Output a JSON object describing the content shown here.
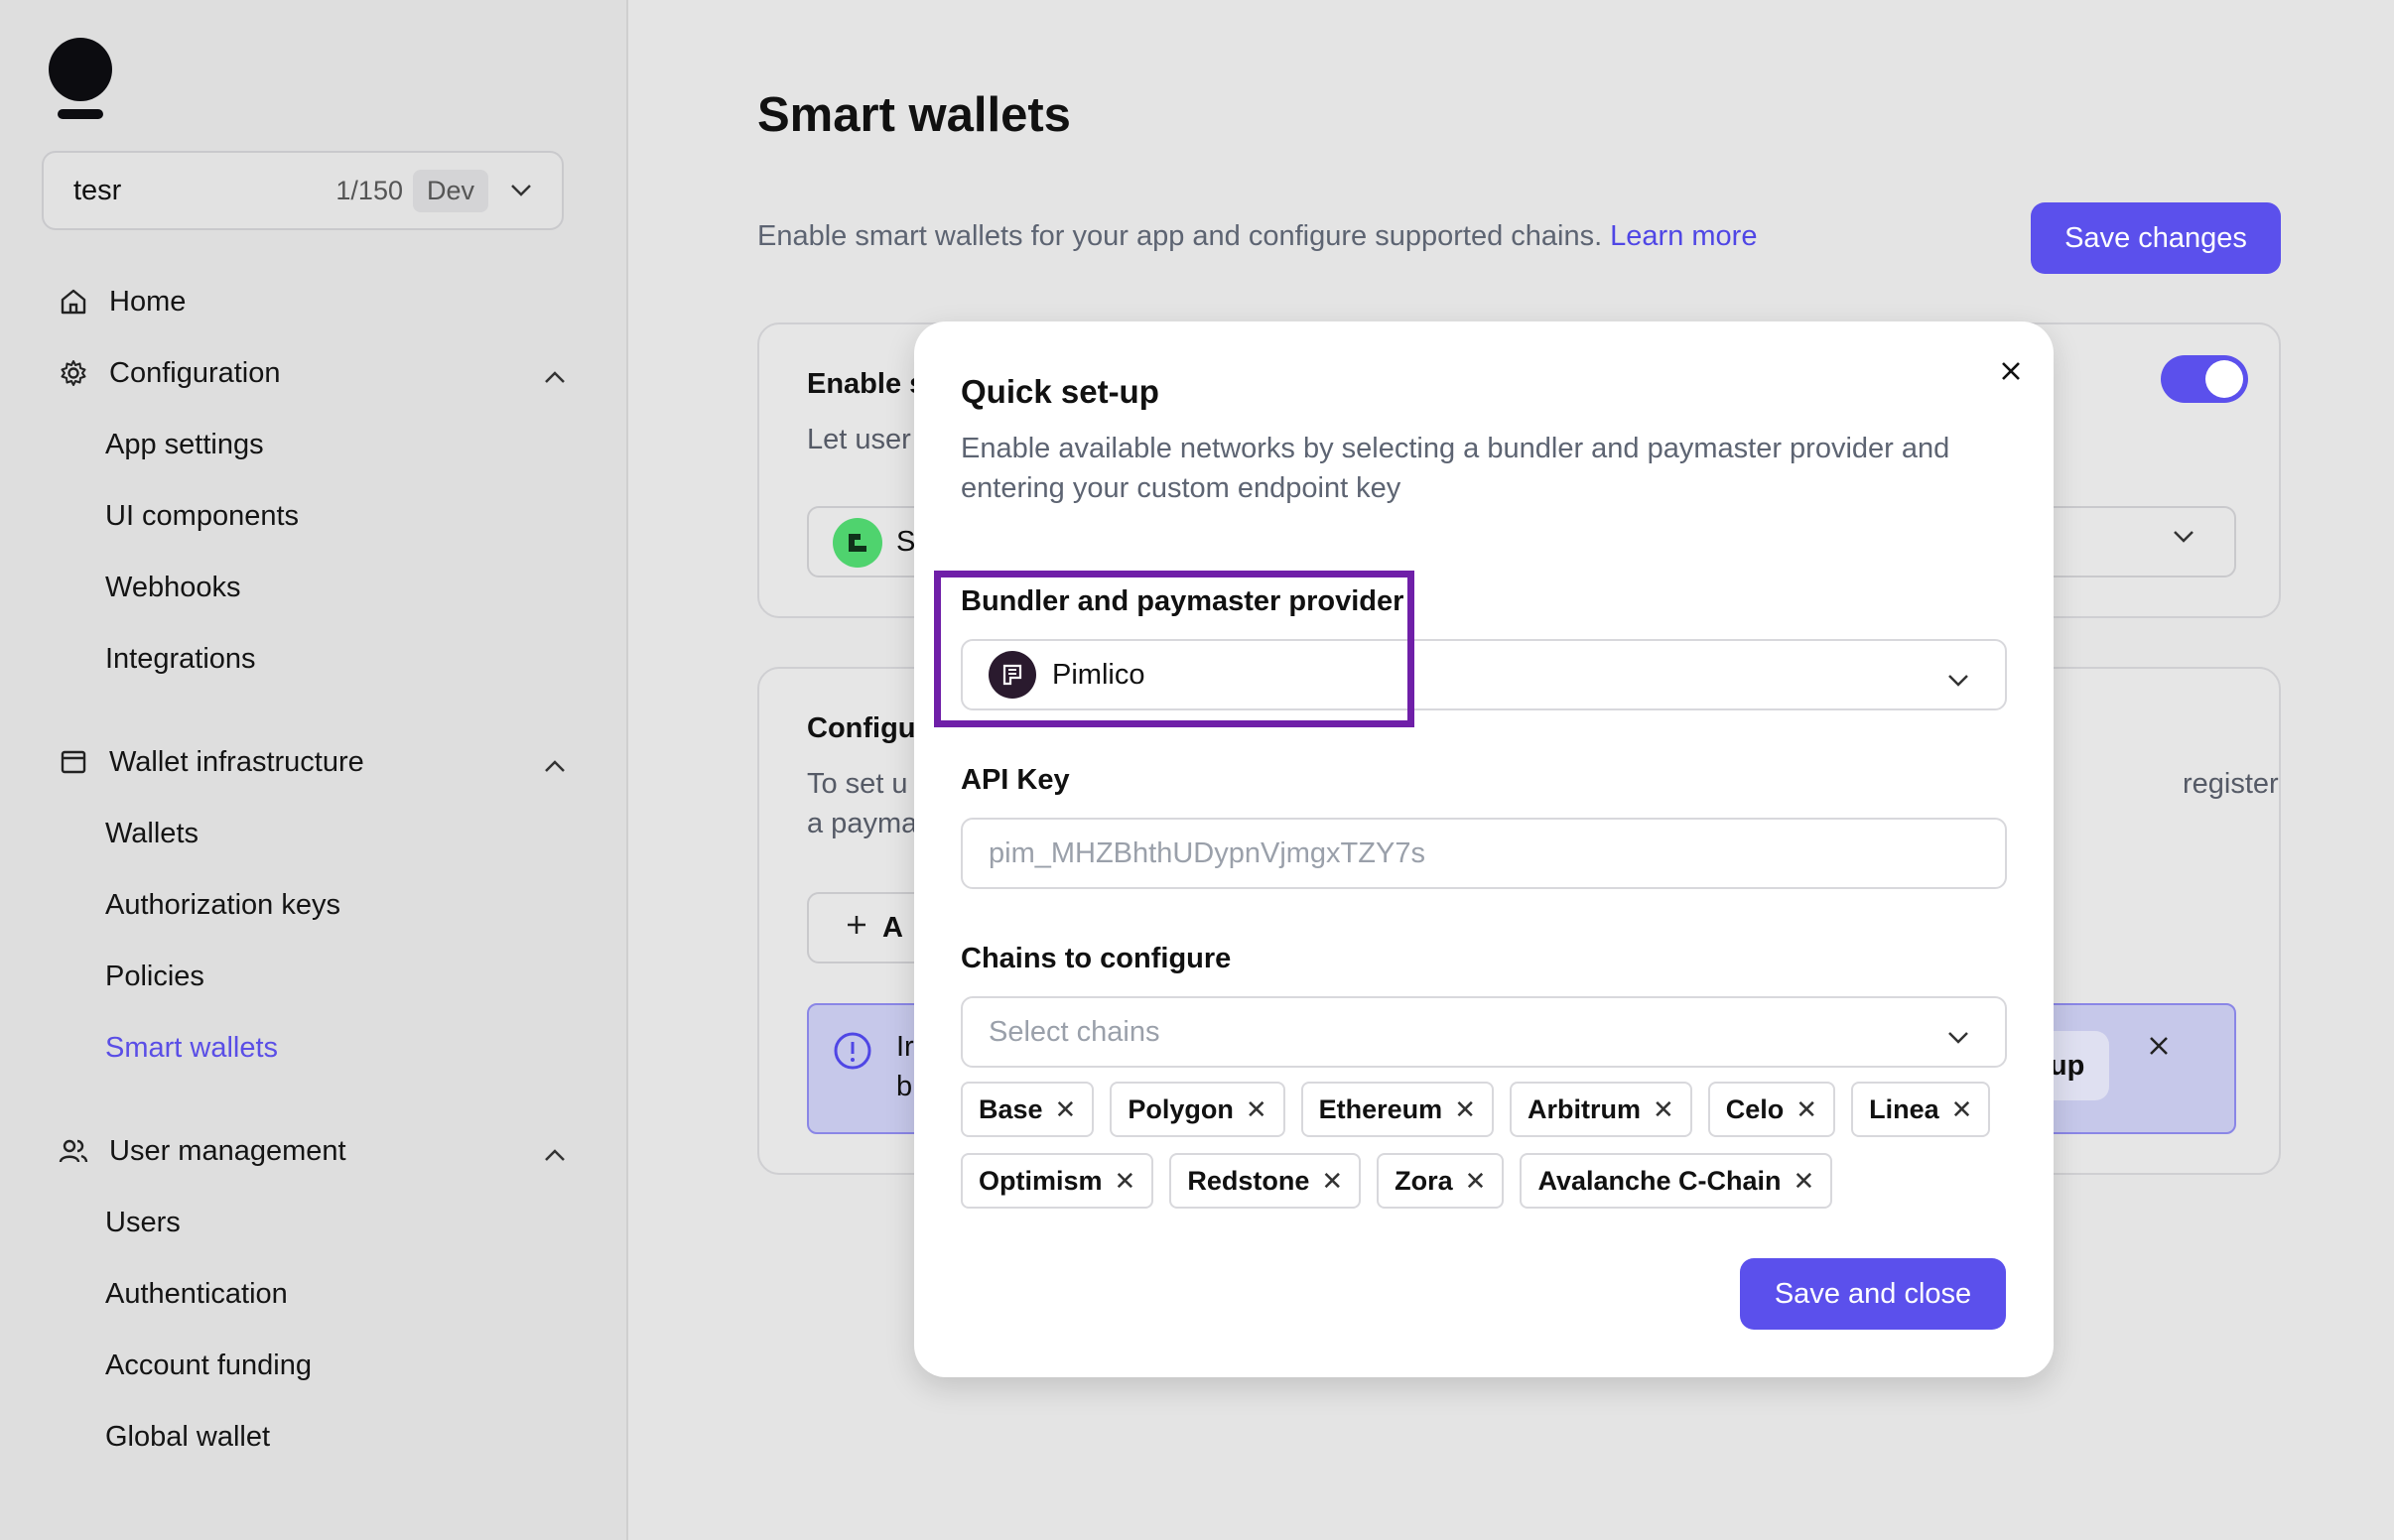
{
  "sidebar": {
    "app_name": "tesr",
    "app_count": "1/150",
    "app_env": "Dev",
    "home": "Home",
    "configuration": {
      "label": "Configuration",
      "items": [
        "App settings",
        "UI components",
        "Webhooks",
        "Integrations"
      ]
    },
    "wallet_infra": {
      "label": "Wallet infrastructure",
      "items": [
        "Wallets",
        "Authorization keys",
        "Policies",
        "Smart wallets"
      ]
    },
    "user_mgmt": {
      "label": "User management",
      "items": [
        "Users",
        "Authentication",
        "Account funding",
        "Global wallet"
      ]
    }
  },
  "main": {
    "title": "Smart wallets",
    "description": "Enable smart wallets for your app and configure supported chains.",
    "learn_more": "Learn more",
    "save_changes": "Save changes",
    "card1": {
      "title_partial": "Enable s",
      "desc_partial": "Let user",
      "select_partial": "S"
    },
    "card2": {
      "title_partial": "Configu",
      "desc_partial_1": "To set u",
      "desc_partial_2": "a payma",
      "desc_right": "register",
      "add_partial": "A",
      "info_partial_1": "Ir",
      "info_partial_2": "b",
      "info_setup": "setup"
    }
  },
  "modal": {
    "title": "Quick set-up",
    "description": "Enable available networks by selecting a bundler and paymaster provider and entering your custom endpoint key",
    "provider_label": "Bundler and paymaster provider",
    "provider_value": "Pimlico",
    "api_label": "API Key",
    "api_placeholder": "pim_MHZBhthUDypnVjmgxTZY7s",
    "chains_label": "Chains to configure",
    "chains_placeholder": "Select chains",
    "chains_row1": [
      "Base",
      "Polygon",
      "Ethereum",
      "Arbitrum",
      "Celo",
      "Linea"
    ],
    "chains_row2": [
      "Optimism",
      "Redstone",
      "Zora",
      "Avalanche C-Chain"
    ],
    "save_close": "Save and close"
  },
  "colors": {
    "accent": "#5b50ec",
    "highlight": "#6f1fa8",
    "link": "#4f46e5"
  }
}
